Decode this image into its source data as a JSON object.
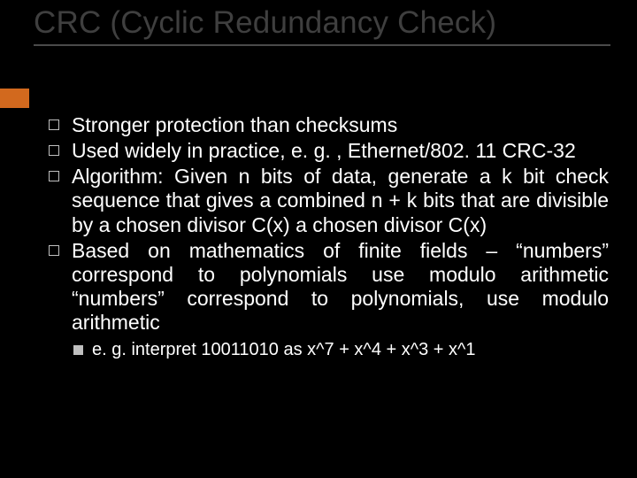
{
  "title": "CRC (Cyclic Redundancy Check)",
  "bullets": [
    "Stronger protection than checksums",
    "Used widely in practice, e. g. , Ethernet/802. 11 CRC-32",
    "Algorithm: Given n bits of data, generate a k bit check sequence that gives a combined n + k bits that are divisible by a chosen divisor C(x) a chosen divisor C(x)",
    "Based on mathematics of finite fields – “numbers” correspond to polynomials use modulo arithmetic “numbers” correspond to polynomials, use modulo arithmetic"
  ],
  "subbullet": "e. g. interpret 10011010 as x^7 + x^4 + x^3 + x^1",
  "accent_color": "#d2691e"
}
